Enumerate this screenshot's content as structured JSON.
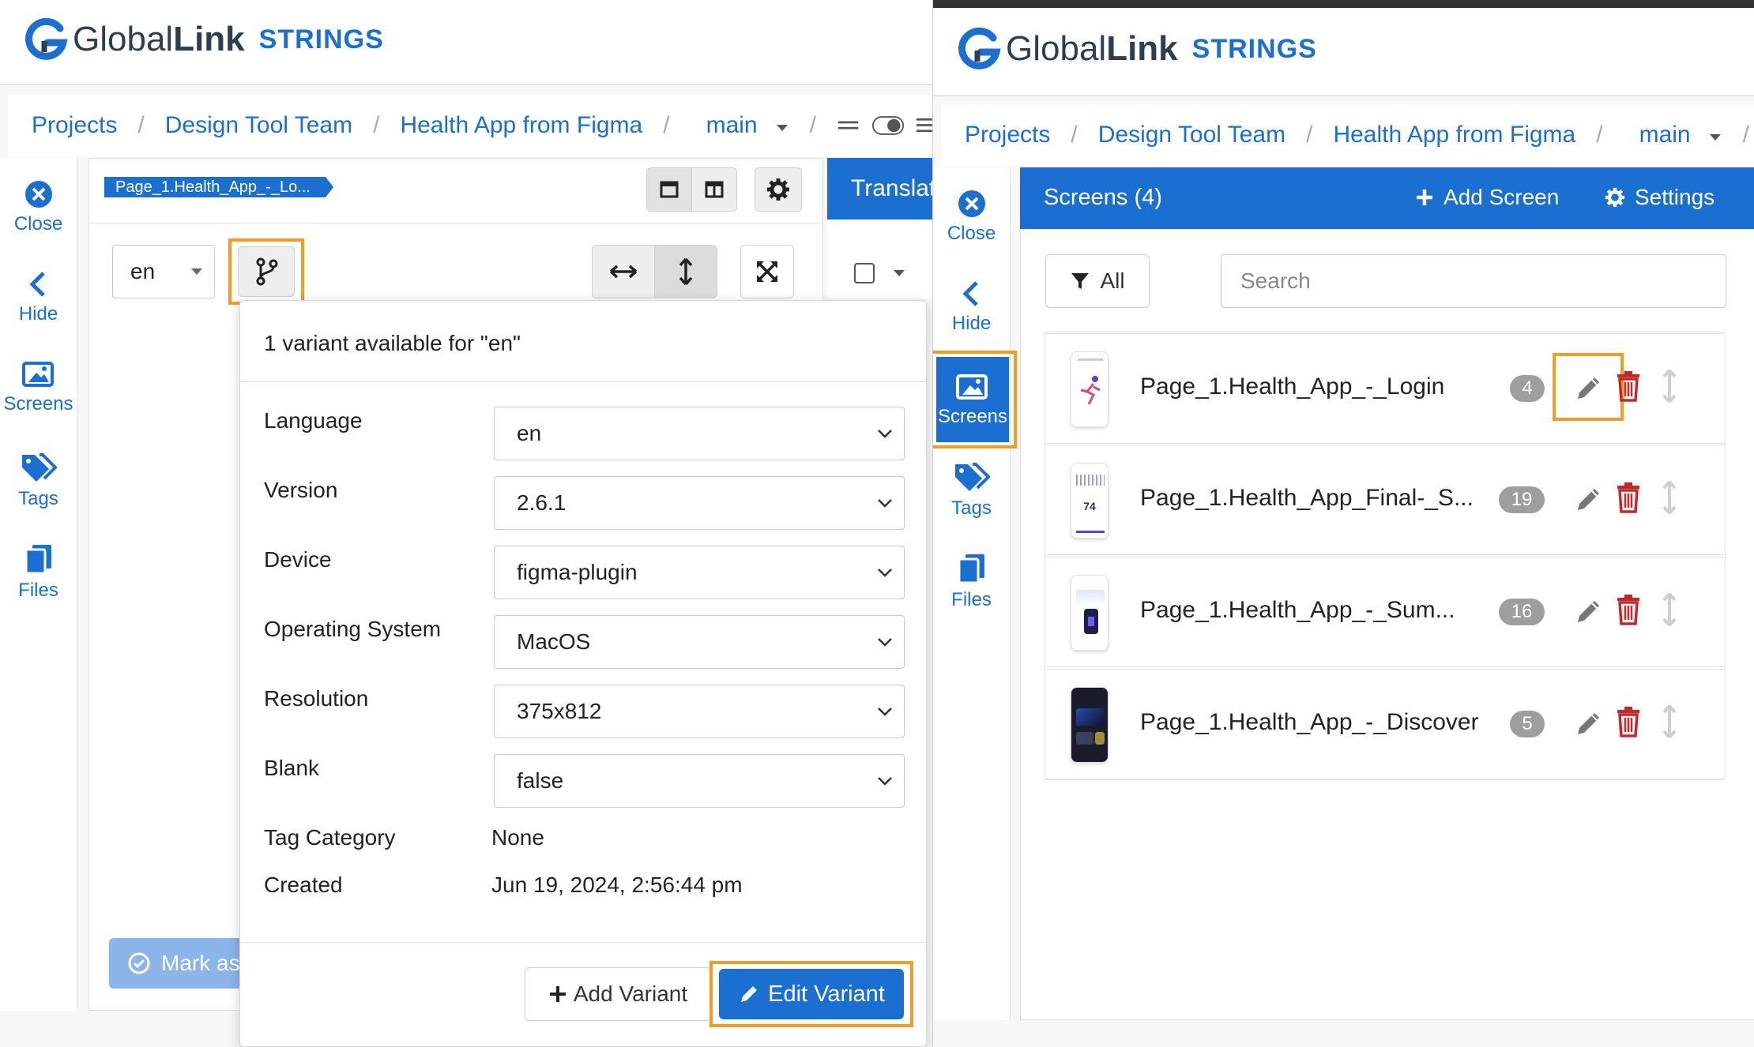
{
  "left": {
    "logo": {
      "name_light": "Global",
      "name_bold": "Link",
      "product": "STRINGS"
    },
    "breadcrumb": [
      "Projects",
      "Design Tool Team",
      "Health App from Figma",
      "main"
    ],
    "sidebar": [
      {
        "label": "Close",
        "icon": "close-circle-icon"
      },
      {
        "label": "Hide",
        "icon": "chevron-left-icon"
      },
      {
        "label": "Screens",
        "icon": "images-icon"
      },
      {
        "label": "Tags",
        "icon": "tags-icon"
      },
      {
        "label": "Files",
        "icon": "files-icon"
      }
    ],
    "screen_tag": "Page_1.Health_App_-_Lo...",
    "translate_tab": "Translat",
    "lang_select": "en",
    "mark_button": "Mark as",
    "variant_popup": {
      "header": "1 variant available for \"en\"",
      "fields": [
        {
          "label": "Language",
          "value": "en"
        },
        {
          "label": "Version",
          "value": "2.6.1"
        },
        {
          "label": "Device",
          "value": "figma-plugin"
        },
        {
          "label": "Operating System",
          "value": "MacOS"
        },
        {
          "label": "Resolution",
          "value": "375x812"
        },
        {
          "label": "Blank",
          "value": "false"
        }
      ],
      "tag_category_label": "Tag Category",
      "tag_category_value": "None",
      "created_label": "Created",
      "created_value": "Jun 19, 2024, 2:56:44 pm",
      "add_variant": "Add Variant",
      "edit_variant": "Edit Variant"
    }
  },
  "right": {
    "logo": {
      "name_light": "Global",
      "name_bold": "Link",
      "product": "STRINGS"
    },
    "breadcrumb": [
      "Projects",
      "Design Tool Team",
      "Health App from Figma",
      "main"
    ],
    "sidebar": [
      {
        "label": "Close",
        "icon": "close-circle-icon"
      },
      {
        "label": "Hide",
        "icon": "chevron-left-icon"
      },
      {
        "label": "Screens",
        "icon": "images-icon"
      },
      {
        "label": "Tags",
        "icon": "tags-icon"
      },
      {
        "label": "Files",
        "icon": "files-icon"
      }
    ],
    "screens_header": "Screens (4)",
    "add_screen": "Add Screen",
    "settings": "Settings",
    "filter_label": "All",
    "search_placeholder": "Search",
    "screens": [
      {
        "name": "Page_1.Health_App_-_Login",
        "count": "4"
      },
      {
        "name": "Page_1.Health_App_Final-_S...",
        "count": "19",
        "thumb_text": "74"
      },
      {
        "name": "Page_1.Health_App_-_Sum...",
        "count": "16"
      },
      {
        "name": "Page_1.Health_App_-_Discover",
        "count": "5"
      }
    ]
  },
  "colors": {
    "brand": "#1a6fd0",
    "highlight": "#f59a23",
    "delete": "#c62828",
    "badge": "#9e9e9e"
  }
}
